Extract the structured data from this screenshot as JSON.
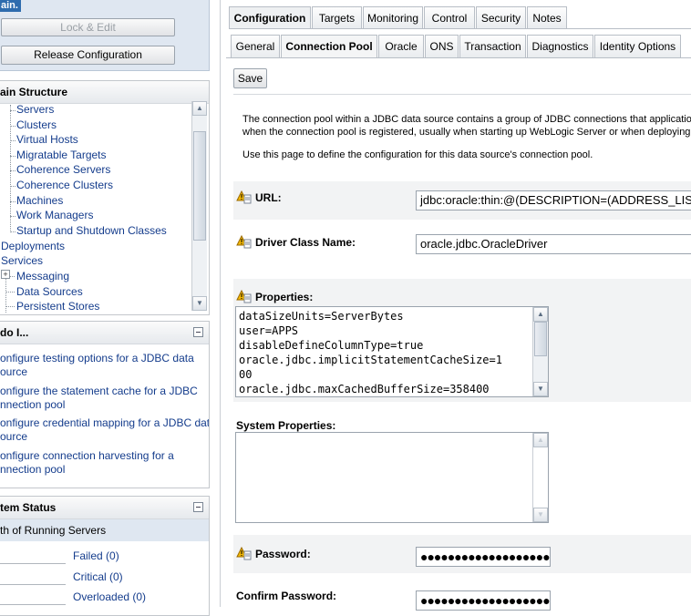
{
  "left": {
    "change_center": {
      "top_text": "ain.",
      "lock_edit": "Lock & Edit",
      "release": "Release Configuration"
    },
    "domain_structure": {
      "title": "ain Structure",
      "items": [
        {
          "label": "Servers"
        },
        {
          "label": "Clusters"
        },
        {
          "label": "Virtual Hosts"
        },
        {
          "label": "Migratable Targets"
        },
        {
          "label": "Coherence Servers"
        },
        {
          "label": "Coherence Clusters"
        },
        {
          "label": "Machines"
        },
        {
          "label": "Work Managers"
        },
        {
          "label": "Startup and Shutdown Classes"
        }
      ],
      "deployments": "Deployments",
      "services": "Services",
      "messaging": "Messaging",
      "data_sources": "Data Sources",
      "persistent_stores": "Persistent Stores",
      "expander": "+"
    },
    "how_do_i": {
      "title": "do I...",
      "links": [
        {
          "l1": "onfigure testing options for a JDBC data",
          "l2": "ource"
        },
        {
          "l1": "onfigure the statement cache for a JDBC",
          "l2": "nnection pool"
        },
        {
          "l1": "onfigure credential mapping for a JDBC data",
          "l2": "ource"
        },
        {
          "l1": "onfigure connection harvesting for a",
          "l2": "nnection pool"
        }
      ]
    },
    "system_status": {
      "title": "tem Status",
      "subtitle": "th of Running Servers",
      "rows": [
        {
          "label": "Failed (0)"
        },
        {
          "label": "Critical (0)"
        },
        {
          "label": "Overloaded (0)"
        }
      ]
    }
  },
  "tabs": [
    "Configuration",
    "Targets",
    "Monitoring",
    "Control",
    "Security",
    "Notes"
  ],
  "subtabs": [
    "General",
    "Connection Pool",
    "Oracle",
    "ONS",
    "Transaction",
    "Diagnostics",
    "Identity Options"
  ],
  "save_label": "Save",
  "intro": {
    "p1_l1": "The connection pool within a JDBC data source contains a group of JDBC connections that applications",
    "p1_l2": "when the connection pool is registered, usually when starting up WebLogic Server or when deploying t",
    "p2": "Use this page to define the configuration for this data source's connection pool."
  },
  "fields": {
    "url": {
      "label": "URL:",
      "value": "jdbc:oracle:thin:@(DESCRIPTION=(ADDRESS_LIST"
    },
    "driver": {
      "label": "Driver Class Name:",
      "value": "oracle.jdbc.OracleDriver"
    },
    "properties": {
      "label": "Properties:",
      "lines": [
        "dataSizeUnits=ServerBytes",
        "user=APPS",
        "disableDefineColumnType=true",
        "oracle.jdbc.implicitStatementCacheSize=1",
        "00",
        "oracle.jdbc.maxCachedBufferSize=358400"
      ]
    },
    "system_properties": {
      "label": "System Properties:",
      "value": ""
    },
    "password": {
      "label": "Password:",
      "value": "●●●●●●●●●●●●●●●●●●●●"
    },
    "confirm_password": {
      "label": "Confirm Password:",
      "value": "●●●●●●●●●●●●●●●●●●●●"
    }
  }
}
